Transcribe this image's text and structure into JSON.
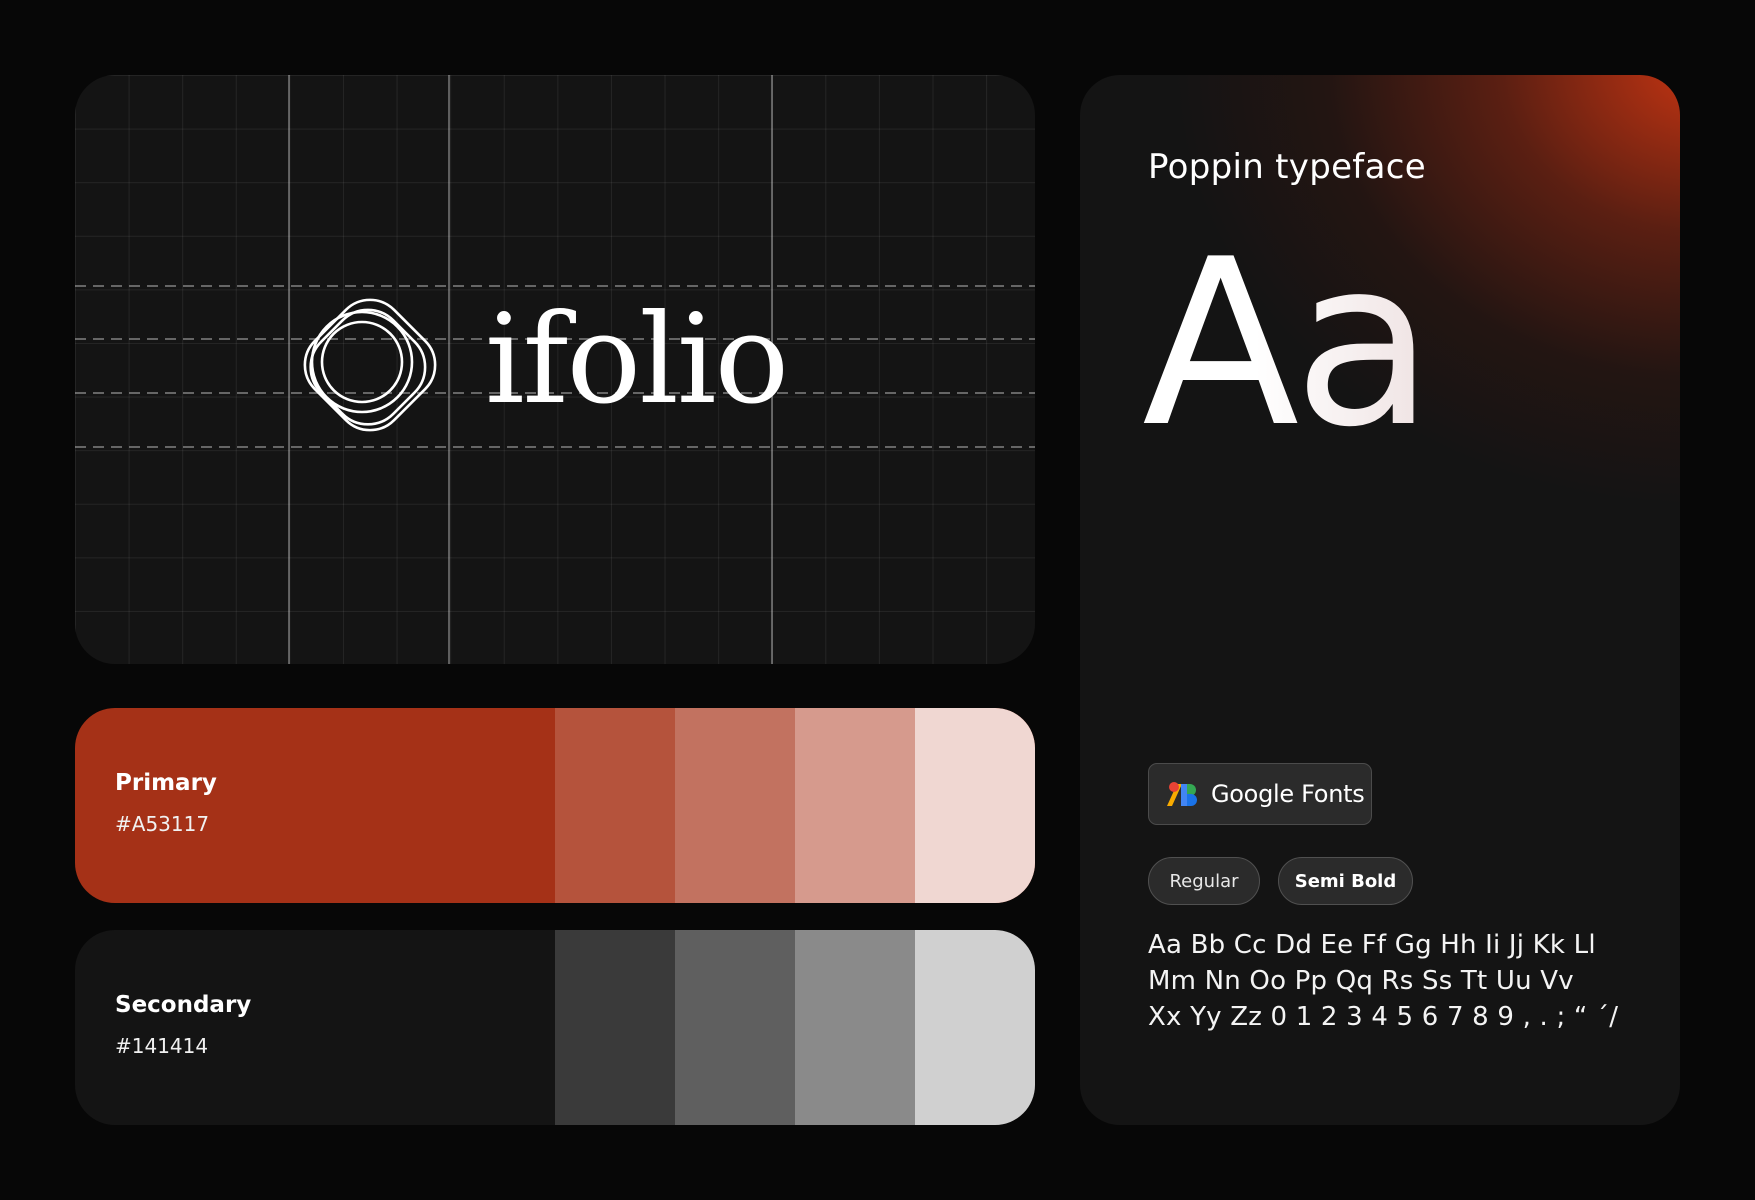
{
  "logo": {
    "wordmark": "ifolio",
    "mark_icon": "rounded-square-rings-icon"
  },
  "palette": {
    "primary": {
      "name": "Primary",
      "hex": "#A53117",
      "tints": [
        "#B5533C",
        "#C27260",
        "#D69A8D",
        "#F0D7D2"
      ]
    },
    "secondary": {
      "name": "Secondary",
      "hex": "#141414",
      "tints": [
        "#3A3A3A",
        "#5F5F5F",
        "#8A8A8A",
        "#D0D0D0"
      ]
    }
  },
  "typography": {
    "title": "Poppin typeface",
    "specimen": "Aa",
    "source_badge": {
      "icon": "google-fonts-icon",
      "label": "Google Fonts"
    },
    "weights": [
      "Regular",
      "Semi Bold"
    ],
    "alphabet": [
      "Aa Bb Cc Dd Ee Ff Gg Hh Ii Jj Kk Ll",
      "Mm Nn Oo Pp Qq Rs Ss Tt Uu Vv",
      "Xx Yy Zz 0 1 2 3 4 5 6 7 8 9 , . ; “ ´/"
    ],
    "accent_color": "#C43412"
  }
}
